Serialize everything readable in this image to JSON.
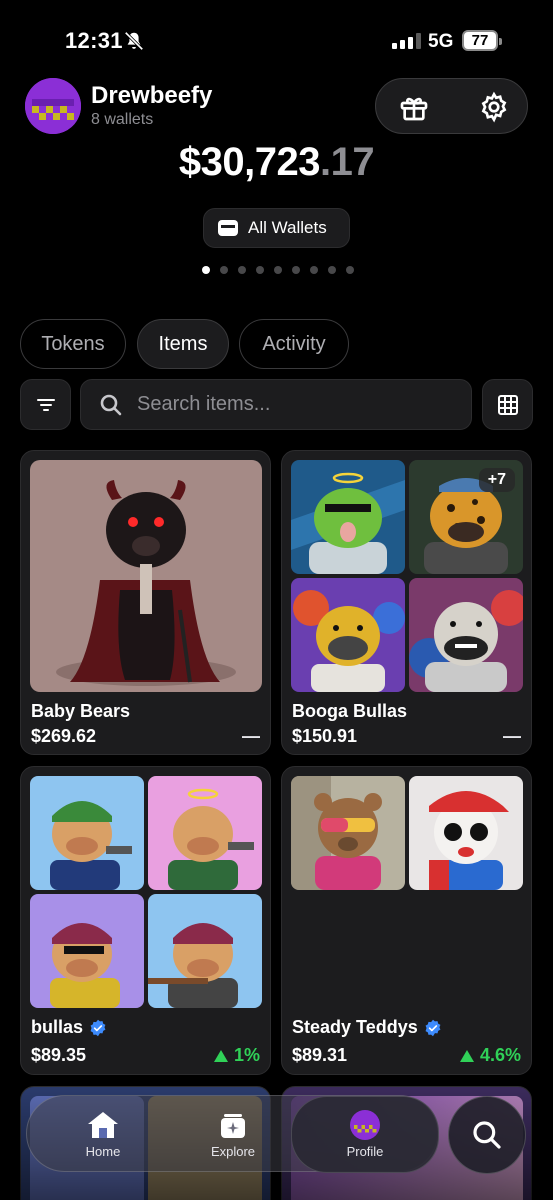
{
  "status_bar": {
    "time": "12:31",
    "network": "5G",
    "battery": "77"
  },
  "header": {
    "username": "Drewbeefy",
    "wallet_count": "8 wallets",
    "balance_whole": "$30,723",
    "balance_decimal": ".17",
    "wallet_selector_label": "All Wallets",
    "page_dots": 9,
    "active_dot": 0
  },
  "tabs": [
    {
      "label": "Tokens",
      "active": false
    },
    {
      "label": "Items",
      "active": true
    },
    {
      "label": "Activity",
      "active": false
    }
  ],
  "search": {
    "placeholder": "Search items..."
  },
  "collections": [
    {
      "name": "Baby Bears",
      "price": "$269.62",
      "change": "—",
      "verified": false
    },
    {
      "name": "Booga Bullas",
      "price": "$150.91",
      "change": "—",
      "more_count": "+7",
      "verified": false
    },
    {
      "name": "bullas",
      "price": "$89.35",
      "change": "1%",
      "change_direction": "up",
      "verified": true
    },
    {
      "name": "Steady Teddys",
      "price": "$89.31",
      "change": "4.6%",
      "change_direction": "up",
      "verified": true
    }
  ],
  "bottom_nav": [
    {
      "label": "Home",
      "icon": "home-icon"
    },
    {
      "label": "Explore",
      "icon": "explore-icon"
    },
    {
      "label": "Profile",
      "icon": "avatar",
      "active": true
    }
  ],
  "colors": {
    "accent_green": "#30d158",
    "avatar_purple": "#8b2fd6",
    "verified_blue": "#3d8bfd"
  }
}
